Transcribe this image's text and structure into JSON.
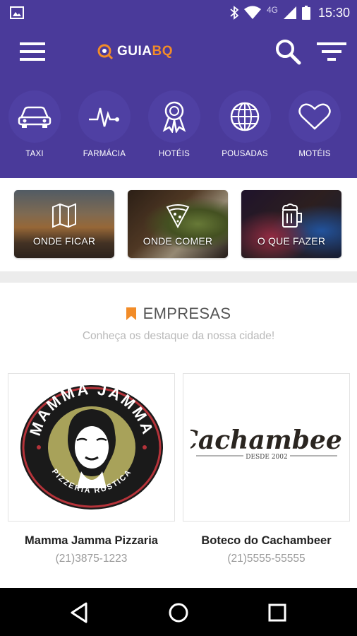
{
  "status_bar": {
    "time": "15:30",
    "network": "4G",
    "icons": [
      "image-icon",
      "bluetooth-icon",
      "wifi-icon",
      "signal-icon",
      "battery-icon"
    ]
  },
  "app_bar": {
    "logo_prefix": "GUIA",
    "logo_suffix": "BQ",
    "icons": [
      "menu-icon",
      "search-icon",
      "filter-icon"
    ]
  },
  "categories": [
    {
      "label": "TAXI",
      "icon": "car-icon"
    },
    {
      "label": "FARMÁCIA",
      "icon": "pulse-icon"
    },
    {
      "label": "HOTÉIS",
      "icon": "award-icon"
    },
    {
      "label": "POUSADAS",
      "icon": "globe-icon"
    },
    {
      "label": "MOTÉIS",
      "icon": "heart-icon"
    }
  ],
  "sections": [
    {
      "label": "ONDE FICAR",
      "icon": "map-icon"
    },
    {
      "label": "ONDE COMER",
      "icon": "pizza-icon"
    },
    {
      "label": "O QUE FAZER",
      "icon": "beer-icon"
    }
  ],
  "empresas": {
    "title": "EMPRESAS",
    "subtitle": "Conheça os destaque da nossa cidade!",
    "items": [
      {
        "name": "Mamma Jamma Pizzaria",
        "phone": "(21)3875-1223",
        "logo_top": "MAMMA JAMMA",
        "logo_bottom": "PIZZERIA RUSTICA"
      },
      {
        "name": "Boteco do Cachambeer",
        "phone": "(21)5555-55555",
        "logo_main": "Cachambeer",
        "logo_sub": "DESDE 2002"
      }
    ]
  },
  "colors": {
    "primary": "#4a3a9a",
    "accent": "#f28c28",
    "category_circle": "#4f40a3"
  },
  "nav_bar": {
    "icons": [
      "back-icon",
      "home-icon",
      "recents-icon"
    ]
  }
}
